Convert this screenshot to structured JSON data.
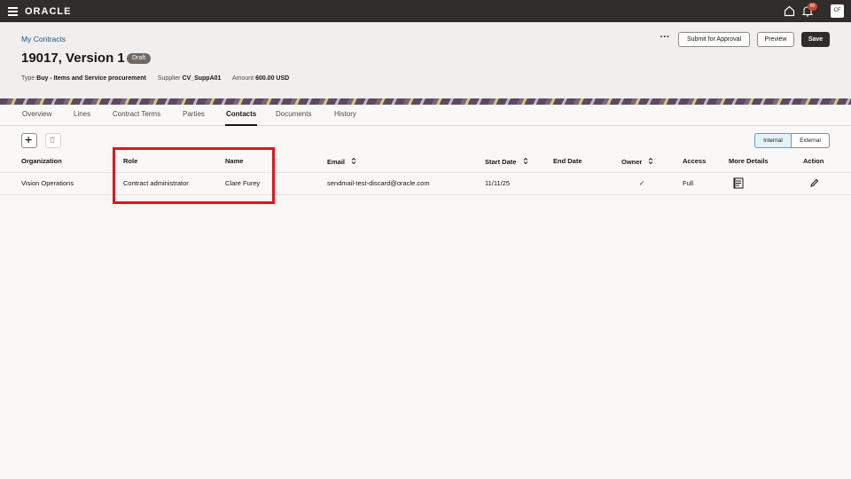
{
  "app": {
    "logo": "ORACLE",
    "notification_count": "60",
    "avatar_initials": "CF"
  },
  "header": {
    "breadcrumb": "My Contracts",
    "title": "19017, Version 1",
    "status": "Draft",
    "meta": [
      {
        "key": "Type",
        "value": "Buy - Items and Service procurement"
      },
      {
        "key": "Supplier",
        "value": "CV_SuppA01"
      },
      {
        "key": "Amount",
        "value": "600.00 USD"
      }
    ],
    "actions": {
      "more": "···",
      "submit": "Submit for Approval",
      "preview": "Preview",
      "save": "Save"
    }
  },
  "tabs": [
    "Overview",
    "Lines",
    "Contract Terms",
    "Parties",
    "Contacts",
    "Documents",
    "History"
  ],
  "active_tab": "Contacts",
  "toolbar": {
    "internal": "Internal",
    "external": "External"
  },
  "table": {
    "columns": [
      "Organization",
      "Role",
      "Name",
      "Email",
      "Start Date",
      "End Date",
      "Owner",
      "Access",
      "More Details",
      "Action"
    ],
    "rows": [
      {
        "organization": "Vision Operations",
        "role": "Contract administrator",
        "name": "Clare Furey",
        "email": "sendmail-test-discard@oracle.com",
        "start_date": "11/11/25",
        "end_date": "",
        "owner": "✓",
        "access": "Full"
      }
    ]
  },
  "colors": {
    "topbar": "#312d2a",
    "header_bg": "#f1efed",
    "highlight": "#e0151d",
    "link": "#1e4f7a"
  }
}
